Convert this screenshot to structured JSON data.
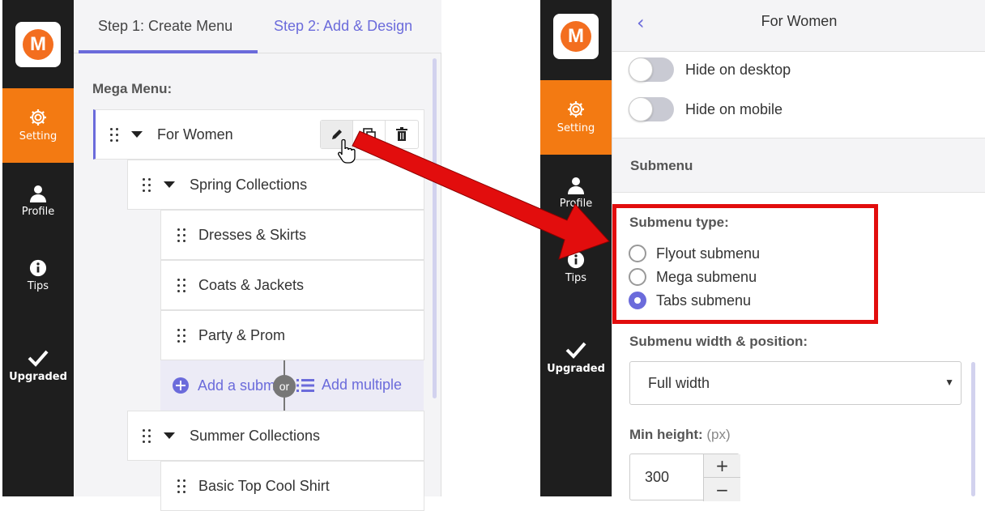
{
  "left_sidebar": {
    "logo": "M",
    "items": [
      {
        "label": "Setting",
        "icon": "gear-icon"
      },
      {
        "label": "Profile",
        "icon": "user-icon"
      },
      {
        "label": "Tips",
        "icon": "info-icon"
      },
      {
        "label": "Upgraded",
        "icon": "checkmark-icon"
      }
    ]
  },
  "right_sidebar": {
    "logo": "M",
    "items": [
      {
        "label": "Setting",
        "icon": "gear-icon"
      },
      {
        "label": "Profile",
        "icon": "user-icon"
      },
      {
        "label": "Tips",
        "icon": "info-icon"
      },
      {
        "label": "Upgraded",
        "icon": "checkmark-icon"
      }
    ]
  },
  "tabs": {
    "step1": "Step 1: Create Menu",
    "step2": "Step 2: Add & Design"
  },
  "mega_menu": {
    "title": "Mega Menu:",
    "items": [
      {
        "label": "For Women"
      },
      {
        "label": "Spring Collections"
      },
      {
        "label": "Dresses & Skirts"
      },
      {
        "label": "Coats & Jackets"
      },
      {
        "label": "Party & Prom"
      },
      {
        "label": "Summer Collections"
      },
      {
        "label": "Basic Top Cool Shirt"
      }
    ],
    "add_submenu": "Add a subm",
    "or": "or",
    "add_multiple": "Add multiple"
  },
  "right_panel": {
    "title": "For Women",
    "hide_desktop": "Hide on desktop",
    "hide_mobile": "Hide on mobile",
    "section": "Submenu",
    "submenu_type_label": "Submenu type:",
    "options": [
      "Flyout submenu",
      "Mega submenu",
      "Tabs submenu"
    ],
    "selected_option": "Tabs submenu",
    "width_label": "Submenu width & position:",
    "width_value": "Full width",
    "min_height_label": "Min height:",
    "min_height_unit": "(px)",
    "min_height_value": "300"
  },
  "colors": {
    "accent": "#6b6bdb",
    "active_sidebar": "#f37a12",
    "highlight_box": "#e20d0d"
  }
}
